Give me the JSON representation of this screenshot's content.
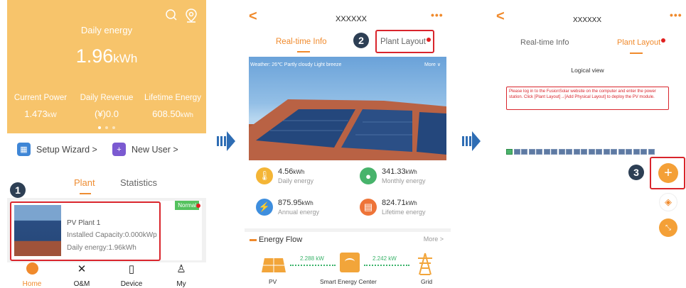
{
  "screen1": {
    "daily_label": "Daily energy",
    "daily_value": "1.96",
    "daily_unit": "kWh",
    "metrics": [
      {
        "label": "Current Power",
        "value": "1.473",
        "unit": "kW"
      },
      {
        "label": "Daily Revenue",
        "value": "(¥)0.0",
        "unit": ""
      },
      {
        "label": "Lifetime Energy",
        "value": "608.50",
        "unit": "kWh"
      }
    ],
    "setup_wizard": "Setup Wizard >",
    "new_user": "New User >",
    "tabs": {
      "plant": "Plant",
      "statistics": "Statistics"
    },
    "plant": {
      "name": "PV Plant 1",
      "capacity": "Installed Capacity:0.000kWp",
      "energy": "Daily energy:1.96kWh",
      "status": "Normal"
    },
    "nav": [
      "Home",
      "O&M",
      "Device",
      "My"
    ],
    "step": "1"
  },
  "screen2": {
    "back": "<",
    "title": "XXXXXX",
    "more_menu": "•••",
    "tab_realtime": "Real-time Info",
    "tab_layout": "Plant Layout",
    "step": "2",
    "weather": "Weather: 26℃ Partly cloudy Light breeze",
    "weather_more": "More ∨",
    "stats": [
      {
        "value": "4.56",
        "unit": "kWh",
        "label": "Daily energy"
      },
      {
        "value": "341.33",
        "unit": "kWh",
        "label": "Monthly energy"
      },
      {
        "value": "875.95",
        "unit": "kWh",
        "label": "Annual energy"
      },
      {
        "value": "824.71",
        "unit": "kWh",
        "label": "Lifetime energy"
      }
    ],
    "energy_flow": "Energy Flow",
    "energy_flow_more": "More >",
    "flow": {
      "pv_kw": "2.288 kW",
      "grid_kw": "2.242 kW",
      "pv": "PV",
      "center": "Smart Energy Center",
      "grid": "Grid"
    }
  },
  "screen3": {
    "back": "<",
    "title": "XXXXXX",
    "more_menu": "•••",
    "tab_realtime": "Real-time Info",
    "tab_layout": "Plant Layout",
    "logical_view": "Logical view",
    "hint": "Please log in to the FusionSolar website on the computer and enter the power station. Click [Plant Layout]→[Add Physical Layout] to deploy the PV module.",
    "step": "3"
  },
  "colors": {
    "accent": "#f08a2c",
    "banner": "#f7c46b",
    "highlight": "#d9252c",
    "step_badge": "#2d3f54",
    "arrow": "#2e6db4"
  }
}
